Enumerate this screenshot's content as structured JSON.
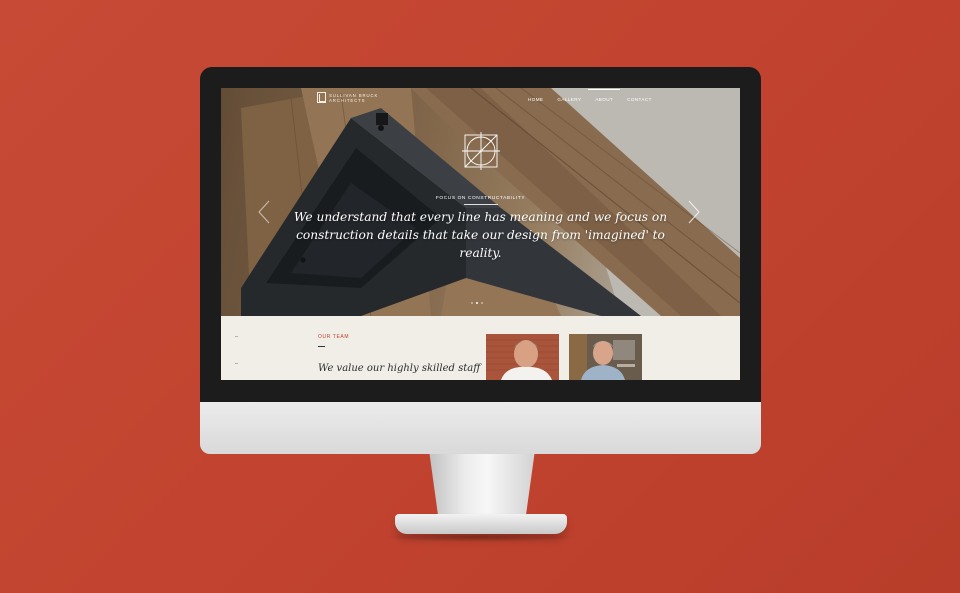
{
  "site": {
    "logo_line1": "SULLIVAN BRUCK",
    "logo_line2": "ARCHITECTS"
  },
  "nav": {
    "items": [
      {
        "label": "HOME"
      },
      {
        "label": "GALLERY"
      },
      {
        "label": "ABOUT",
        "active": true
      },
      {
        "label": "CONTACT"
      }
    ]
  },
  "hero": {
    "kicker": "FOCUS ON CONSTRUCTABILITY",
    "headline": "We understand that every line has meaning and we focus on construction details that take our design from 'imagined' to reality.",
    "slides": 3,
    "active_slide": 2
  },
  "team": {
    "label": "OUR TEAM",
    "heading": "We value our highly skilled staff"
  },
  "colors": {
    "background": "#c4472f",
    "accent": "#c0412c",
    "section_bg": "#f1eee8"
  },
  "icons": {
    "prev": "chevron-left-icon",
    "next": "chevron-right-icon",
    "emblem": "compass-circle-icon"
  }
}
